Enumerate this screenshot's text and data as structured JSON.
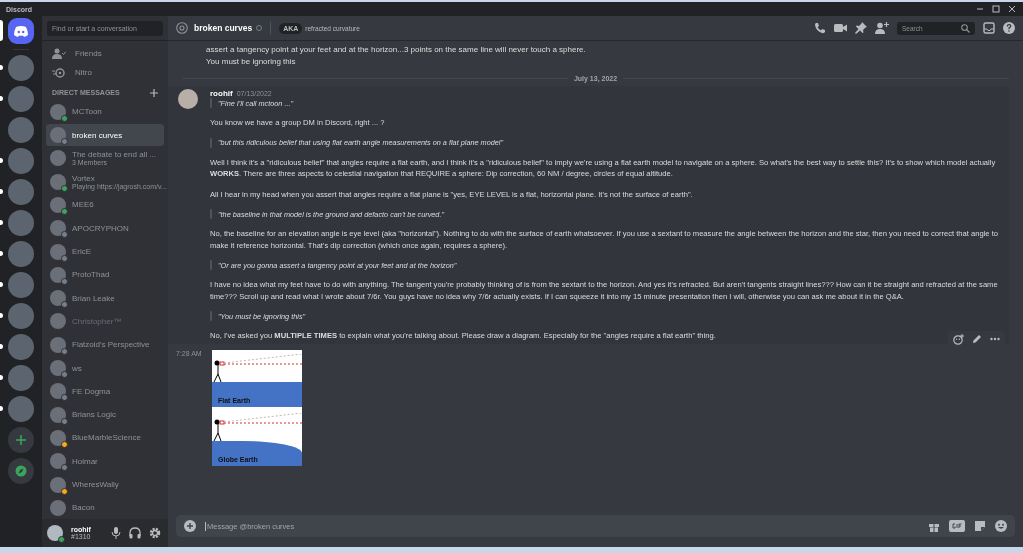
{
  "window": {
    "title": "Discord"
  },
  "servers": [
    {
      "kind": "home",
      "selected": true
    },
    {
      "kind": "guild",
      "selected": false,
      "unread": true
    },
    {
      "kind": "guild",
      "selected": false,
      "unread": true
    },
    {
      "kind": "guild",
      "selected": false,
      "unread": false
    },
    {
      "kind": "guild",
      "selected": false,
      "unread": true
    },
    {
      "kind": "guild",
      "selected": false,
      "unread": true
    },
    {
      "kind": "guild",
      "selected": false,
      "unread": true
    },
    {
      "kind": "guild",
      "selected": false,
      "unread": true
    },
    {
      "kind": "guild",
      "selected": false,
      "unread": true
    },
    {
      "kind": "guild",
      "selected": false,
      "unread": true
    },
    {
      "kind": "guild",
      "selected": false,
      "unread": true
    },
    {
      "kind": "guild",
      "selected": false,
      "unread": true
    },
    {
      "kind": "guild",
      "selected": false,
      "unread": true
    },
    {
      "kind": "add",
      "selected": false,
      "unread": false
    },
    {
      "kind": "explore",
      "selected": false,
      "unread": false
    }
  ],
  "search": {
    "placeholder": "Find or start a conversation"
  },
  "nav": [
    {
      "kind": "friends",
      "label": "Friends"
    },
    {
      "kind": "nitro",
      "label": "Nitro"
    }
  ],
  "dm_header": "DIRECT MESSAGES",
  "dms": [
    {
      "name": "MCToon",
      "color": "#3ba55d",
      "selected": false,
      "dim": false
    },
    {
      "name": "broken curves",
      "color": "#747f8d",
      "selected": true,
      "dim": false
    },
    {
      "name": "The debate to end all ...",
      "sub": "3 Members",
      "selected": false,
      "dim": false
    },
    {
      "name": "Vortex",
      "sub": "Playing https://jagrosh.com/v...",
      "color": "#3ba55d",
      "selected": false,
      "dim": false
    },
    {
      "name": "MEE6",
      "color": "#3ba55d",
      "selected": false,
      "dim": false
    },
    {
      "name": "APOCRYPHON",
      "color": "#747f8d",
      "selected": false,
      "dim": false
    },
    {
      "name": "EricE",
      "color": "#747f8d",
      "selected": false,
      "dim": false
    },
    {
      "name": "ProtoThad",
      "color": "#747f8d",
      "selected": false,
      "dim": false
    },
    {
      "name": "Brian Leake",
      "color": "#747f8d",
      "selected": false,
      "dim": false
    },
    {
      "name": "Christopher™",
      "selected": false,
      "dim": true
    },
    {
      "name": "Flatzoid's Perspective",
      "color": "#747f8d",
      "selected": false,
      "dim": false
    },
    {
      "name": "ws",
      "color": "#747f8d",
      "selected": false,
      "dim": false
    },
    {
      "name": "FE Dogma",
      "color": "#747f8d",
      "selected": false,
      "dim": false
    },
    {
      "name": "Brians Logic",
      "color": "#747f8d",
      "selected": false,
      "dim": false
    },
    {
      "name": "BlueMarbleScience",
      "color": "#faa81a",
      "selected": false,
      "dim": false
    },
    {
      "name": "Hoimar",
      "color": "#747f8d",
      "selected": false,
      "dim": false
    },
    {
      "name": "WheresWally",
      "color": "#faa81a",
      "selected": false,
      "dim": false
    },
    {
      "name": "Bacon",
      "selected": false,
      "dim": false
    }
  ],
  "user": {
    "name": "roohif",
    "tag": "#1310",
    "color": "#3ba55d"
  },
  "channel": {
    "name": "broken curves",
    "aka_badge": "AKA",
    "aka": "refracted curvature"
  },
  "header_search": {
    "placeholder": "Search"
  },
  "prev_lines": [
    "assert a tangency point at your feet and at the horizon...3 points on the same line will never touch a sphere.",
    "You must be ignoring this"
  ],
  "date_divider": "July 13, 2022",
  "message": {
    "author": "roohif",
    "timestamp": "07/13/2022",
    "blocks": [
      {
        "kind": "quote",
        "text": "\"Fine I'll call mctoon ...\""
      },
      {
        "kind": "text",
        "text": "You know we have a group DM in Discord, right ... ?"
      },
      {
        "kind": "quote",
        "text": "\"but this ridiculous belief that using flat earth angle measurements on a flat plane model\""
      },
      {
        "kind": "text",
        "text": "Well I think it's a \"ridiculous belief\" that angles require a flat earth, and I think it's a \"ridiculous belief\" to imply we're using a flat earth model to navigate on a sphere. So what's the best way to settle this? It's to show which model actually **WORKS**. There are three aspects to celestial navigation that REQUIRE a sphere: Dip correction, 60 NM / degree, circles of equal altitude."
      },
      {
        "kind": "text",
        "text": "All I hear in my head when you assert that angles require a flat plane is \"yes, EYE LEVEL is a flat, horizontal plane. It's not the surface of earth\"."
      },
      {
        "kind": "quote",
        "text": "\"the baseline in that model is the ground and defacto can't be curved.\""
      },
      {
        "kind": "text",
        "text": "No, the baseline for an elevation angle is eye level (aka \"horizontal\"). Nothing to do with the surface of earth whatsoever. If you use a sextant to measure the angle between the horizon and the star, then you need to correct that angle to make it reference horizontal. That's dip correction (which once again, requires a sphere)."
      },
      {
        "kind": "quote",
        "text": "\"Or are you gonna assert a tangency point at your feet and at the horizon\""
      },
      {
        "kind": "text",
        "text": "I have no idea what my feet have to do with anything. The tangent you're probably thinking of is from the sextant to the horizon. And yes it's refracted. But aren't tangents straight lines??? How can it be straight and refracted at the same time??? Scroll up and read what I wrote about 7/6r. You guys have no idea why 7/6r actually exists. If I can squeeze it into my 15 minute presentation then I will, otherwise you can ask me about it in the Q&A."
      },
      {
        "kind": "quote",
        "text": "\"You must be ignoring this\""
      },
      {
        "kind": "text",
        "text": "No, I've asked you **MULTIPLE TIMES** to explain what you're talking about. Please draw a diagram. Especially for the \"angles require a flat earth\" thing."
      }
    ]
  },
  "attachment": {
    "time": "7:28 AM",
    "labels": [
      "Flat Earth",
      "Globe Earth"
    ]
  },
  "composer": {
    "placeholder": "Message @broken curves"
  }
}
